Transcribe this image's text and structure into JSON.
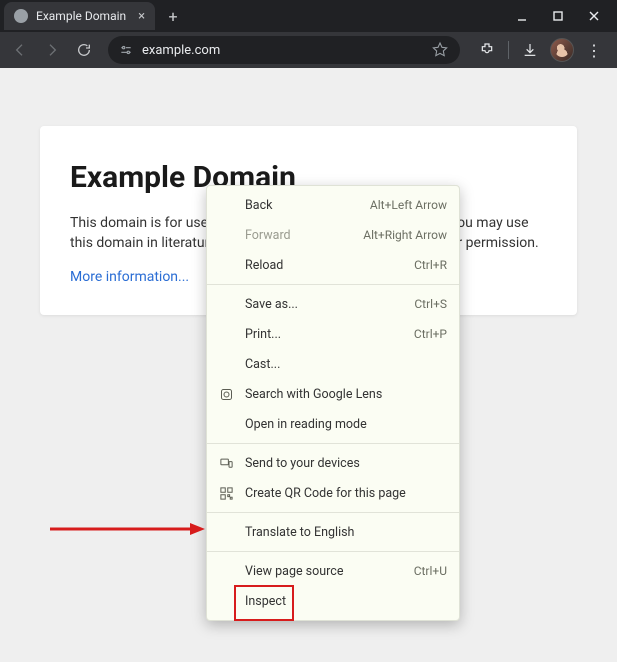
{
  "window": {
    "tab_title": "Example Domain",
    "url": "example.com"
  },
  "page": {
    "heading": "Example Domain",
    "paragraph": "This domain is for use in illustrative examples in documents. You may use this domain in literature without prior coordination or asking for permission.",
    "link_text": "More information..."
  },
  "context_menu": {
    "items": [
      {
        "label": "Back",
        "shortcut": "Alt+Left Arrow",
        "icon": null,
        "disabled": false
      },
      {
        "label": "Forward",
        "shortcut": "Alt+Right Arrow",
        "icon": null,
        "disabled": true
      },
      {
        "label": "Reload",
        "shortcut": "Ctrl+R",
        "icon": null,
        "disabled": false
      },
      {
        "sep": true
      },
      {
        "label": "Save as...",
        "shortcut": "Ctrl+S",
        "icon": null,
        "disabled": false
      },
      {
        "label": "Print...",
        "shortcut": "Ctrl+P",
        "icon": null,
        "disabled": false
      },
      {
        "label": "Cast...",
        "shortcut": "",
        "icon": null,
        "disabled": false
      },
      {
        "label": "Search with Google Lens",
        "shortcut": "",
        "icon": "lens",
        "disabled": false
      },
      {
        "label": "Open in reading mode",
        "shortcut": "",
        "icon": null,
        "disabled": false
      },
      {
        "sep": true
      },
      {
        "label": "Send to your devices",
        "shortcut": "",
        "icon": "devices",
        "disabled": false
      },
      {
        "label": "Create QR Code for this page",
        "shortcut": "",
        "icon": "qr",
        "disabled": false
      },
      {
        "sep": true
      },
      {
        "label": "Translate to English",
        "shortcut": "",
        "icon": null,
        "disabled": false
      },
      {
        "sep": true
      },
      {
        "label": "View page source",
        "shortcut": "Ctrl+U",
        "icon": null,
        "disabled": false
      },
      {
        "label": "Inspect",
        "shortcut": "",
        "icon": null,
        "disabled": false,
        "highlight": true
      }
    ]
  }
}
